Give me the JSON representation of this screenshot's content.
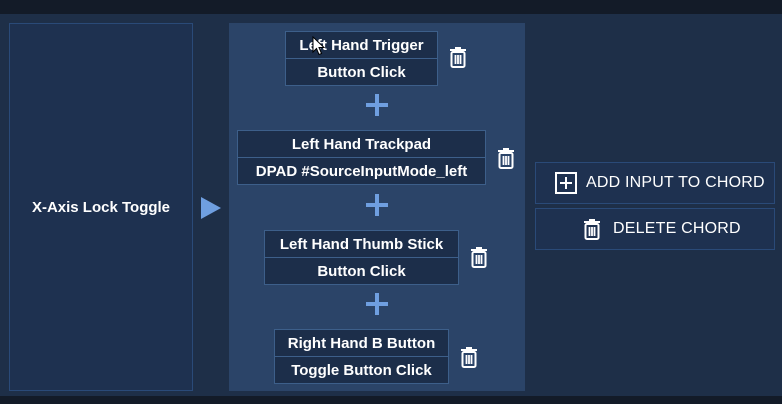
{
  "action": {
    "label": "X-Axis Lock Toggle"
  },
  "chord": {
    "inputs": [
      {
        "source": "Left Hand Trigger",
        "mode": "Button Click"
      },
      {
        "source": "Left Hand Trackpad",
        "mode": "DPAD #SourceInputMode_left"
      },
      {
        "source": "Left Hand Thumb Stick",
        "mode": "Button Click"
      },
      {
        "source": "Right Hand B Button",
        "mode": "Toggle Button Click"
      }
    ]
  },
  "buttons": {
    "add_input": "ADD INPUT TO CHORD",
    "delete_chord": "DELETE CHORD"
  },
  "icons": {
    "trash": "trash-icon",
    "plus": "plus-icon",
    "arrow": "arrow-right-icon",
    "add": "plus-square-icon"
  },
  "colors": {
    "accent": "#6f9fe0",
    "panel": "#1e2f48",
    "chord_column": "#2b4468"
  }
}
